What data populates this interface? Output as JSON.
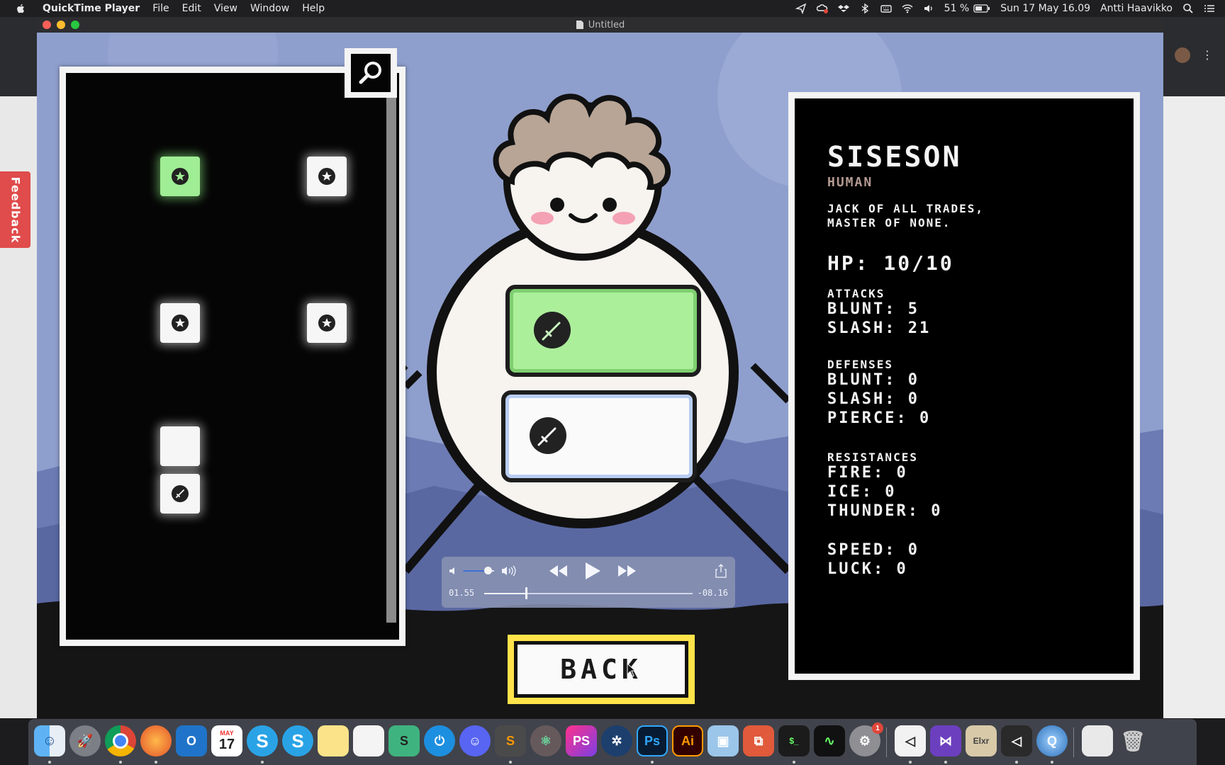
{
  "menubar": {
    "app_name": "QuickTime Player",
    "items": [
      "File",
      "Edit",
      "View",
      "Window",
      "Help"
    ],
    "battery": "51 %",
    "datetime": "Sun 17 May  16.09",
    "user": "Antti Haavikko"
  },
  "feedback_tab": "Feedback",
  "window": {
    "title": "Untitled"
  },
  "player": {
    "elapsed": "01.55",
    "remaining": "-08.16",
    "progress": 0.2,
    "volume": 0.8
  },
  "game": {
    "back_label": "BACK",
    "character": {
      "name": "SISESON",
      "race": "HUMAN",
      "description": "JACK OF ALL TRADES,\nMASTER OF NONE.",
      "hp": "HP: 10/10",
      "attacks_header": "ATTACKS",
      "attacks": [
        "BLUNT: 5",
        "SLASH: 21"
      ],
      "defenses_header": "DEFENSES",
      "defenses": [
        "BLUNT: 0",
        "SLASH: 0",
        "PIERCE: 0"
      ],
      "resistances_header": "RESISTANCES",
      "resistances": [
        "FIRE: 0",
        "ICE: 0",
        "THUNDER: 0"
      ],
      "extra": [
        "SPEED: 0",
        "LUCK: 0"
      ]
    },
    "inventory_icons": [
      "star-badge",
      "star-badge",
      "star-badge",
      "star-badge",
      "empty",
      "sword-badge"
    ],
    "equipped_icons": [
      "sword-icon",
      "sword-icon"
    ],
    "colors": {
      "equipped_highlight": "#acef9b",
      "back_outline": "#ffe34a",
      "race_text": "#b49a92"
    }
  },
  "dock": {
    "apps": [
      "Finder",
      "Launchpad",
      "Chrome",
      "Firefox",
      "Outlook",
      "Calendar",
      "Skype",
      "Skype",
      "Notes",
      "Lists",
      "Sublime",
      "Clock",
      "Discord",
      "Sublime Text",
      "Atom",
      "PhpStorm",
      "Sourcetree",
      "Photoshop",
      "Illustrator",
      "VirtualBox",
      "Screen Sharing",
      "Terminal",
      "Activity Monitor",
      "System Preferences",
      "Unity",
      "Visual Studio",
      "Elixir",
      "Unity Hub",
      "QuickTime",
      "Archive",
      "Trash"
    ],
    "calendar_month": "MAY",
    "calendar_day": "17",
    "ps_label": "PS",
    "photoshop_label": "Ps",
    "illustrator_label": "Ai",
    "sysprefs_badge": "1"
  }
}
